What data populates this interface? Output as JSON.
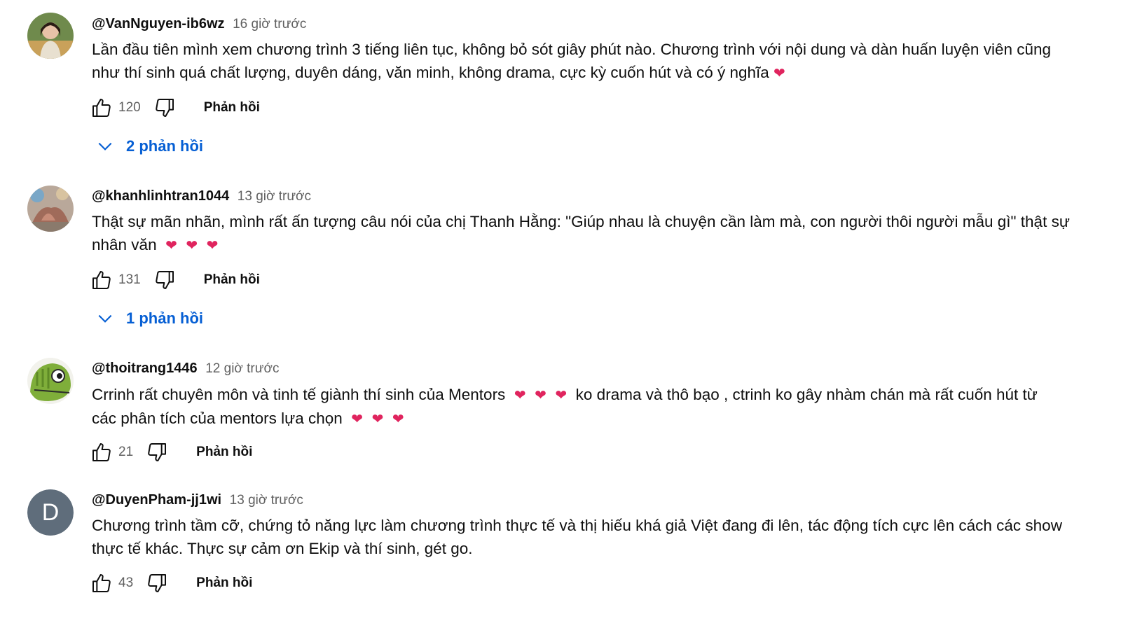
{
  "comments": [
    {
      "author": "@VanNguyen-ib6wz",
      "time": "16 giờ trước",
      "text_line1": "Lần đầu tiên mình xem chương trình 3 tiếng liên tục, không bỏ sót giây phút nào. Chương trình với nội dung và dàn huấn luyện viên cũng",
      "text_line2": "như thí sinh quá chất lượng, duyên dáng, văn minh, không drama, cực kỳ cuốn hút và có ý nghĩa",
      "likes": "120",
      "reply_label": "Phản hồi",
      "replies_label": "2 phản hồi"
    },
    {
      "author": "@khanhlinhtran1044",
      "time": "13 giờ trước",
      "text_line1": "Thật sự mãn nhãn, mình rất ấn tượng câu nói của chị Thanh Hằng: \"Giúp nhau là chuyện cần làm mà, con người thôi người mẫu gì\" thật sự",
      "text_line2": "nhân văn",
      "likes": "131",
      "reply_label": "Phản hồi",
      "replies_label": "1 phản hồi"
    },
    {
      "author": "@thoitrang1446",
      "time": "12 giờ trước",
      "text_line1a": "Crrinh rất chuyên môn và tinh tế giành thí sinh  của Mentors",
      "text_line1b": "ko drama và thô bạo , ctrinh ko gây nhàm chán mà rất cuốn hút từ",
      "text_line2": "các phân tích của mentors lựa chọn",
      "likes": "21",
      "reply_label": "Phản hồi"
    },
    {
      "author": "@DuyenPham-jj1wi",
      "time": "13 giờ trước",
      "avatar_letter": "D",
      "text_line1": "Chương trình tầm cỡ, chứng tỏ năng lực làm chương trình thực tế và thị hiếu khá giả Việt đang đi lên, tác động tích cực lên cách các show",
      "text_line2": "thực tế khác. Thực sự cảm ơn Ekip và thí sinh, gét go.",
      "likes": "43",
      "reply_label": "Phản hồi"
    }
  ],
  "emoji": {
    "heart": "❤"
  },
  "colors": {
    "link_blue": "#065fd4",
    "secondary_text": "#606060",
    "heart": "#e0245e",
    "avatar_d_bg": "#5f6d7b"
  }
}
